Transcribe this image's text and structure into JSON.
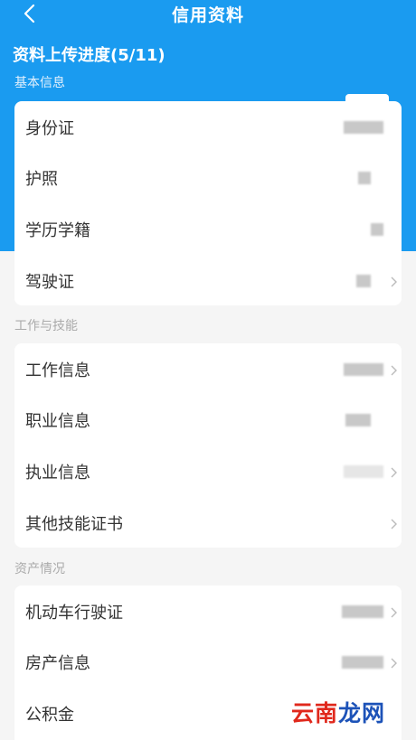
{
  "header": {
    "title": "信用资料",
    "back_icon": "chevron-left-icon"
  },
  "progress": {
    "label": "资料上传进度(5/11)",
    "uploaded": 5,
    "total": 11
  },
  "sections": [
    {
      "title": "基本信息",
      "items": [
        "身份证",
        "护照",
        "学历学籍",
        "驾驶证"
      ]
    },
    {
      "title": "工作与技能",
      "items": [
        "工作信息",
        "职业信息",
        "执业信息",
        "其他技能证书"
      ]
    },
    {
      "title": "资产情况",
      "items": [
        "机动车行驶证",
        "房产信息",
        "公积金"
      ]
    }
  ],
  "watermark": {
    "part1": "云南",
    "part2": "龙网"
  },
  "colors": {
    "header_blue": "#1a9bf0",
    "text_dark": "#333333",
    "section_grey": "#aaaaaa",
    "watermark_red": "#e0281c",
    "watermark_blue": "#1c52b8"
  }
}
